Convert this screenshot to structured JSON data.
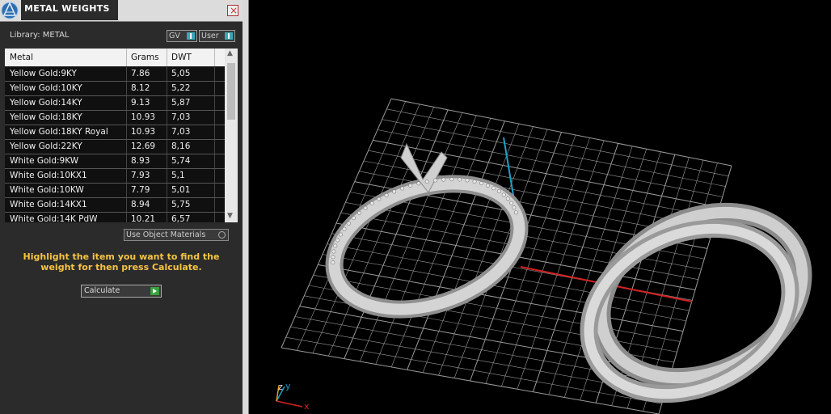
{
  "panel": {
    "title": "METAL WEIGHTS",
    "close_glyph": "×",
    "library_label": "Library: METAL",
    "toggles": [
      {
        "label": "GV"
      },
      {
        "label": "User"
      }
    ],
    "table": {
      "columns": [
        "Metal",
        "Grams",
        "DWT"
      ],
      "rows": [
        [
          "Yellow Gold:9KY",
          "7.86",
          "5,05"
        ],
        [
          "Yellow Gold:10KY",
          "8.12",
          "5,22"
        ],
        [
          "Yellow Gold:14KY",
          "9.13",
          "5,87"
        ],
        [
          "Yellow Gold:18KY",
          "10.93",
          "7,03"
        ],
        [
          "Yellow Gold:18KY Royal",
          "10.93",
          "7,03"
        ],
        [
          "Yellow Gold:22KY",
          "12.69",
          "8,16"
        ],
        [
          "White Gold:9KW",
          "8.93",
          "5,74"
        ],
        [
          "White Gold:10KX1",
          "7.93",
          "5,1"
        ],
        [
          "White Gold:10KW",
          "7.79",
          "5,01"
        ],
        [
          "White Gold:14KX1",
          "8.94",
          "5,75"
        ],
        [
          "White Gold:14K PdW",
          "10.21",
          "6,57"
        ]
      ]
    },
    "use_object_materials_label": "Use Object Materials",
    "hint": "Highlight the item you want to find the weight for then press Calculate.",
    "calculate_label": "Calculate"
  },
  "viewport": {
    "axis_labels": {
      "z": "z",
      "y": "y",
      "x": "x"
    },
    "colors": {
      "grid": "#9a9a9a",
      "x_axis": "#d22222",
      "y_axis": "#1aa3c8",
      "metal": "#c9c9c9",
      "hint": "#f6c443"
    }
  }
}
